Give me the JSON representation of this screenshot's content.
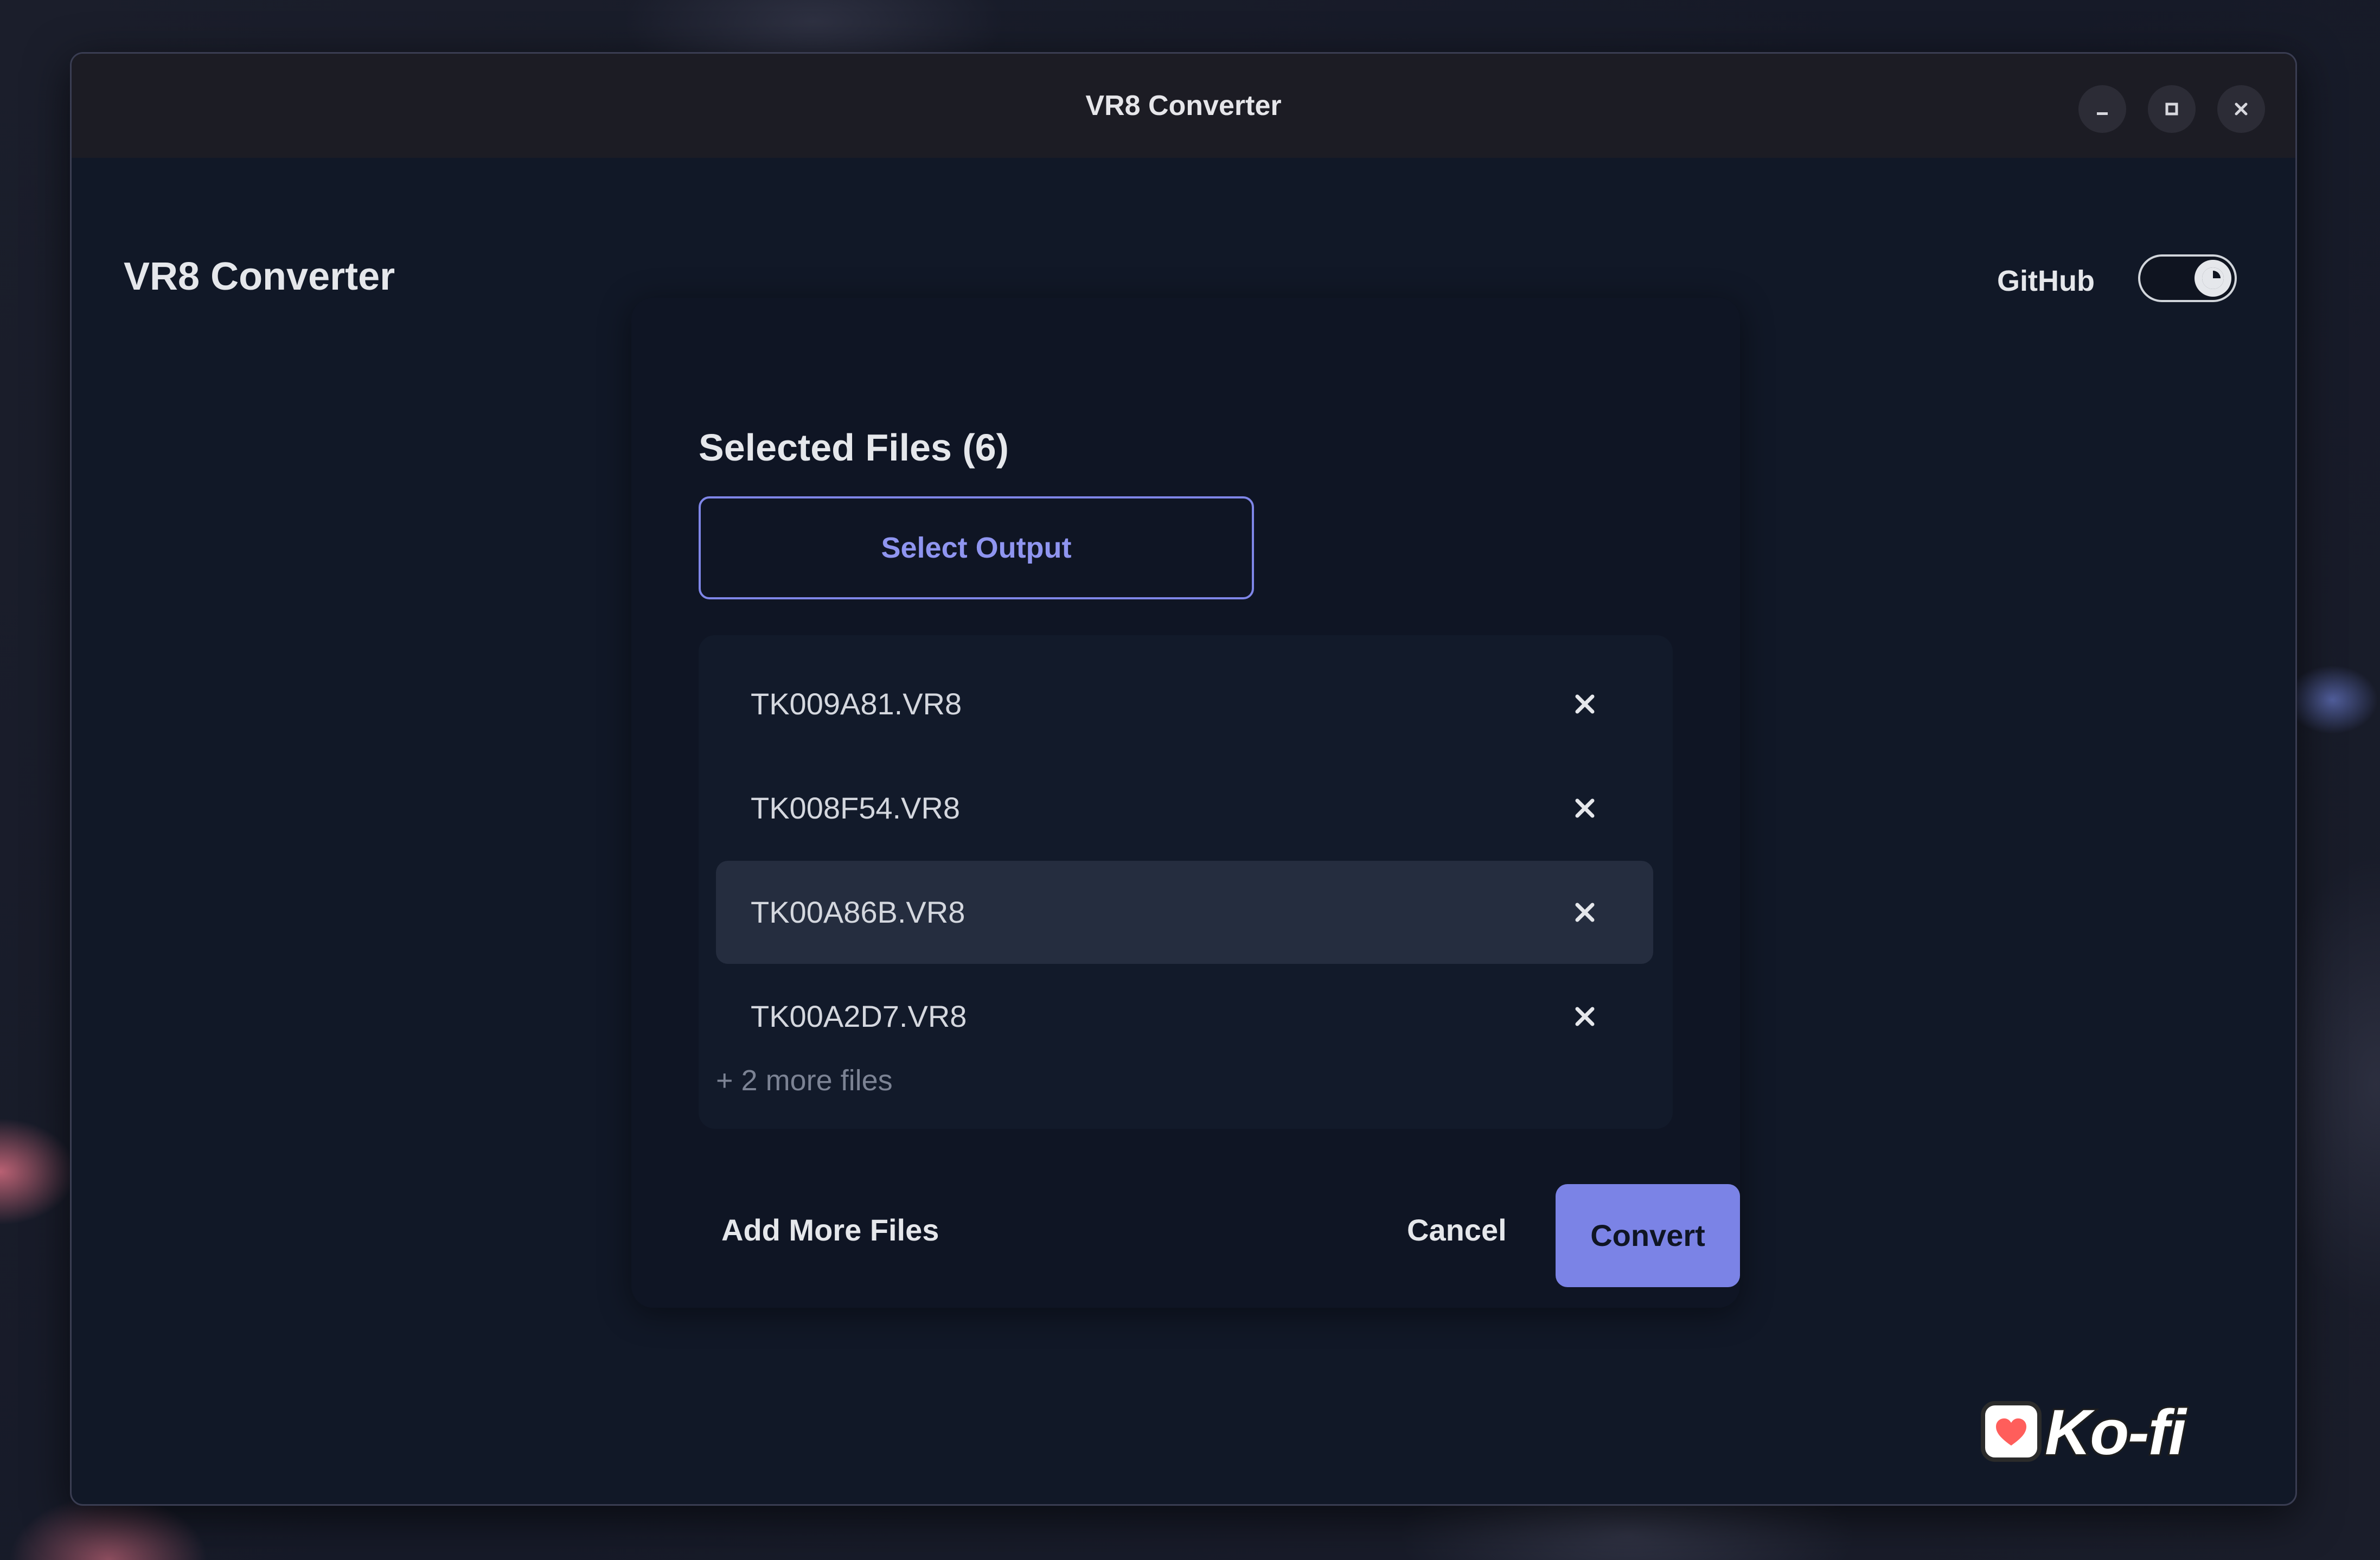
{
  "window": {
    "title": "VR8 Converter",
    "controls": {
      "minimize_icon": "minimize-icon",
      "maximize_icon": "maximize-icon",
      "close_icon": "close-icon"
    }
  },
  "header": {
    "app_title": "VR8 Converter",
    "github_label": "GitHub",
    "theme_toggle": {
      "state": "dark",
      "icon": "moon-icon"
    }
  },
  "card": {
    "heading": "Selected Files (6)",
    "select_output_label": "Select Output",
    "files": [
      {
        "name": "TK009A81.VR8",
        "highlighted": false
      },
      {
        "name": "TK008F54.VR8",
        "highlighted": false
      },
      {
        "name": "TK00A86B.VR8",
        "highlighted": true
      },
      {
        "name": "TK00A2D7.VR8",
        "highlighted": false
      }
    ],
    "remove_icon": "close-icon",
    "more_files_label": "+ 2 more files",
    "add_more_label": "Add More Files",
    "cancel_label": "Cancel",
    "convert_label": "Convert"
  },
  "kofi": {
    "text": "Ko-fi"
  },
  "colors": {
    "background": "#111827",
    "titlebar": "#1c1c24",
    "accent": "#7b83e6",
    "highlight_row": "#252d3f"
  }
}
